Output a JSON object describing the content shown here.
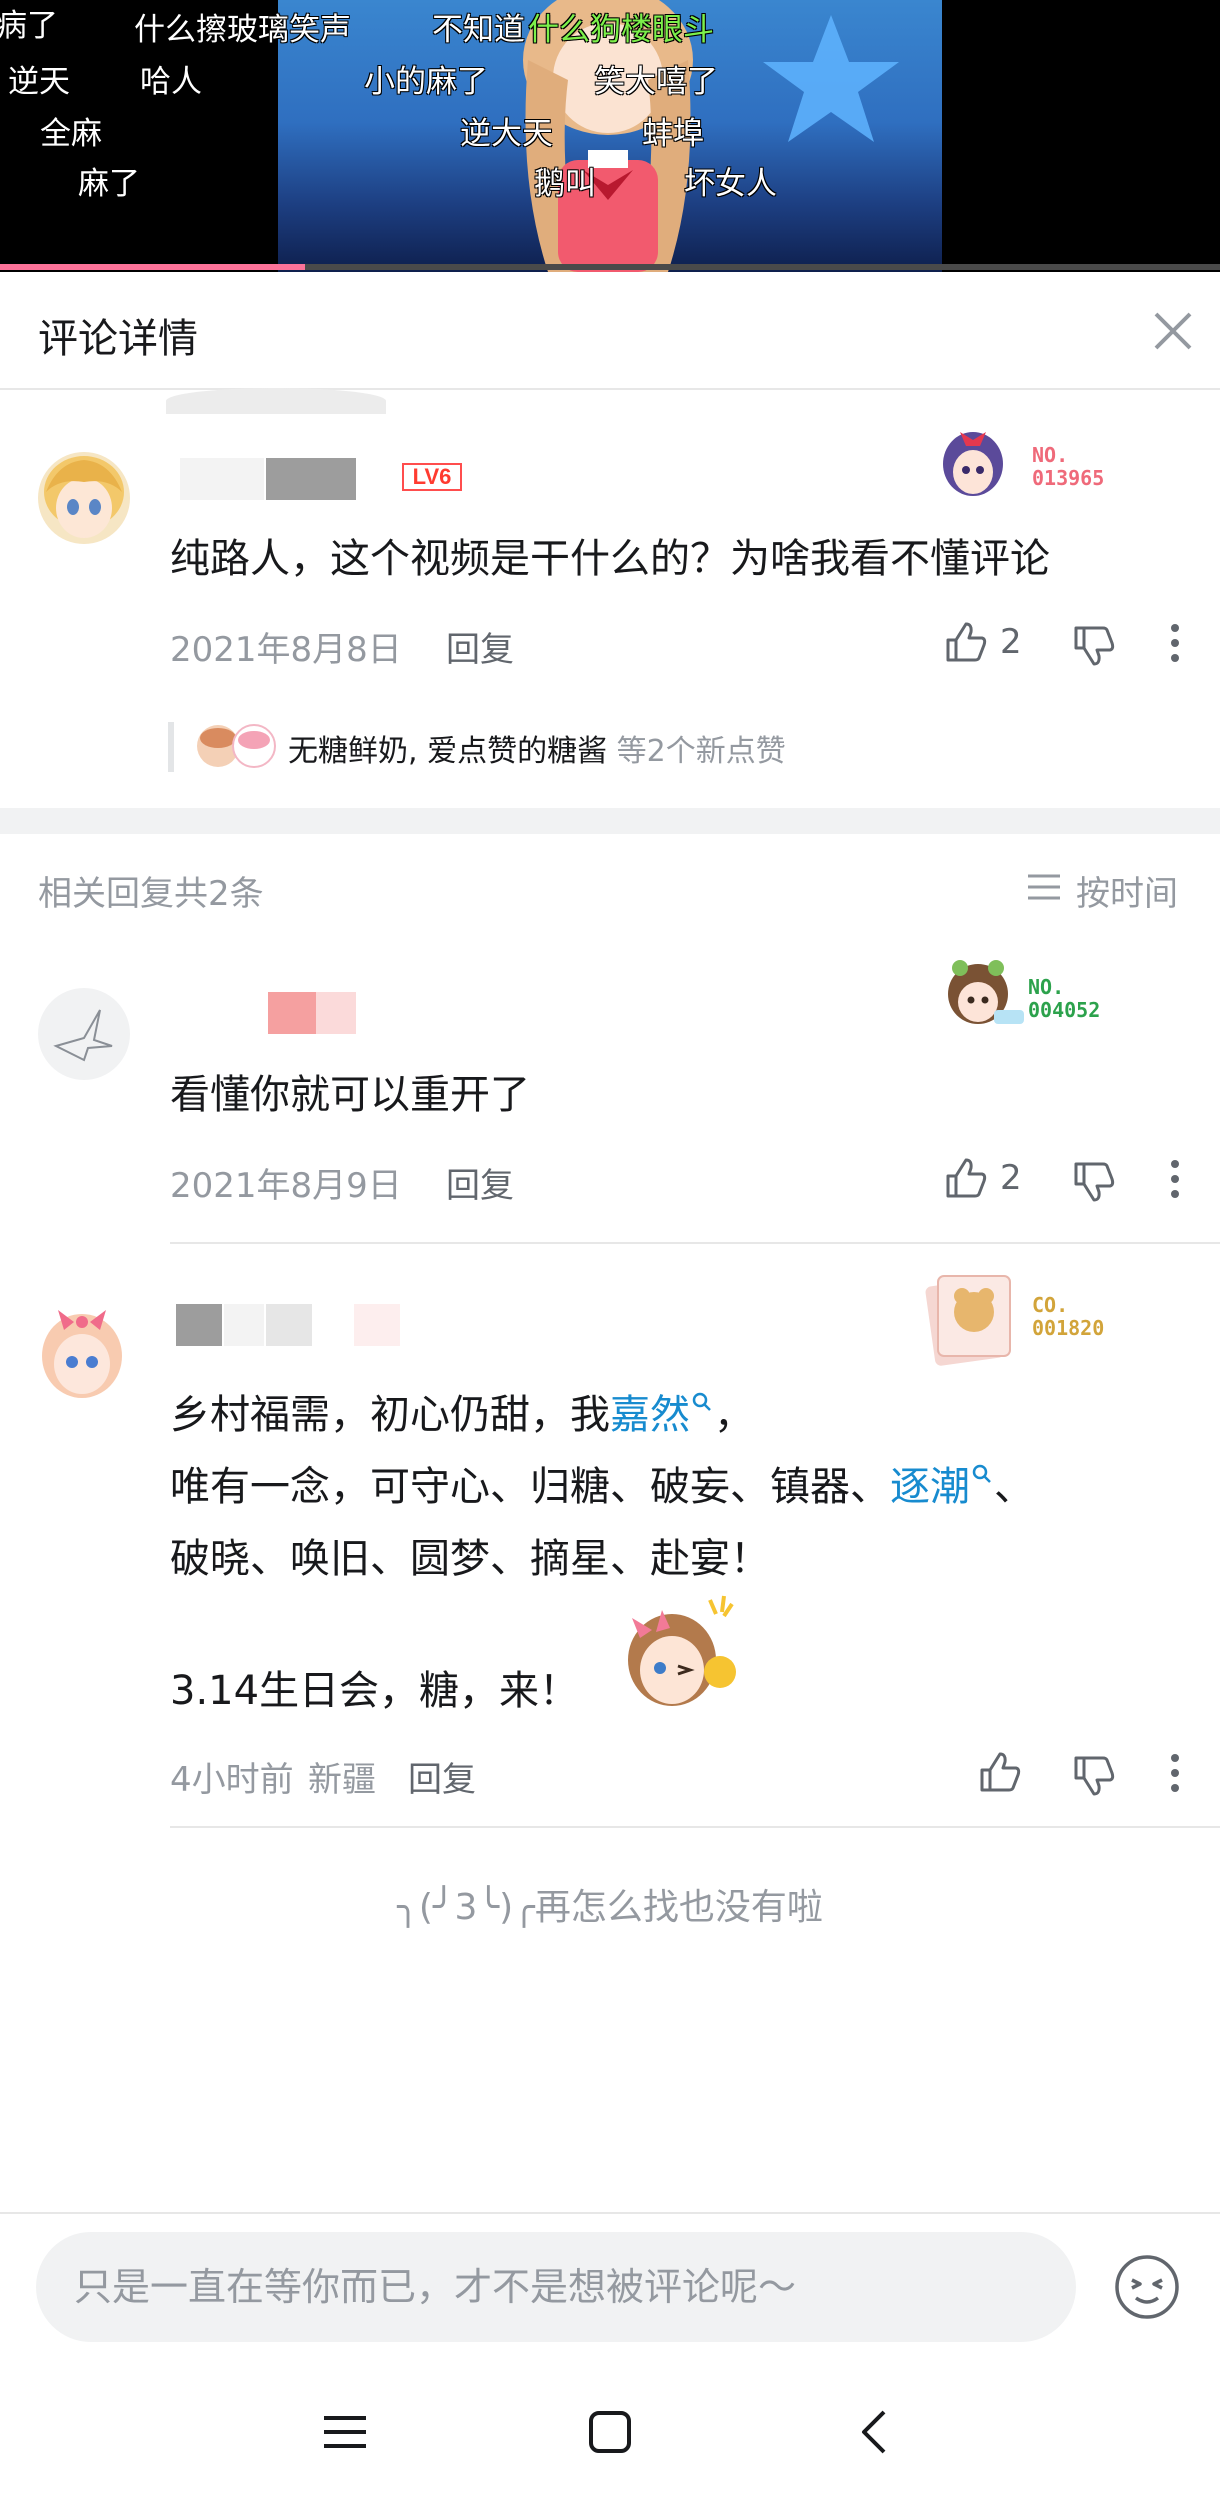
{
  "video": {
    "danmaku": [
      {
        "text": "病了",
        "green": false
      },
      {
        "text": "什么擦玻璃笑声",
        "green": false
      },
      {
        "text": "不知道",
        "green": false
      },
      {
        "text": "什么狗楼眼斗",
        "green": true
      },
      {
        "text": "逆天",
        "green": false
      },
      {
        "text": "哈人",
        "green": false
      },
      {
        "text": "小的麻了",
        "green": false
      },
      {
        "text": "笑大嘻了",
        "green": false
      },
      {
        "text": "全麻",
        "green": false
      },
      {
        "text": "逆大天",
        "green": false
      },
      {
        "text": "蚌埠",
        "green": false
      },
      {
        "text": "麻了",
        "green": false
      },
      {
        "text": "鹅叫",
        "green": false
      },
      {
        "text": "坏女人",
        "green": false
      }
    ],
    "progress_fraction": 0.25
  },
  "header": {
    "title": "评论详情",
    "close_icon": "close-icon"
  },
  "main_comment": {
    "level": "LV6",
    "badge_no": "NO.",
    "badge_num": "013965",
    "text": "纯路人，这个视频是干什么的？为啥我看不懂评论",
    "date": "2021年8月8日",
    "reply_label": "回复",
    "likes": "2",
    "likers_names": "无糖鲜奶, 爱点赞的糖酱",
    "likers_extra": " 等2个新点赞"
  },
  "replies_section": {
    "count_label": "相关回复共2条",
    "sort_label": "按时间"
  },
  "replies": [
    {
      "badge_no": "NO.",
      "badge_num": "004052",
      "text": "看懂你就可以重开了",
      "date": "2021年8月9日",
      "reply_label": "回复",
      "likes": "2"
    },
    {
      "badge_no": "CO.",
      "badge_num": "001820",
      "line1_pre": "乡村福需，初心仍甜，我",
      "line1_link": "嘉然",
      "line1_post": "，",
      "line2_pre": "唯有一念，可守心、归糖、破妄、镇器、",
      "line2_link": "逐潮",
      "line2_post": "、",
      "line3": "破晓、唤旧、圆梦、摘星、赴宴！",
      "line4": "3.14生日会，糖，来！",
      "time": "4小时前",
      "location": "新疆",
      "reply_label": "回复"
    }
  ],
  "end_text": "╮(╯3╰)╭再怎么找也没有啦",
  "input": {
    "placeholder": "只是一直在等你而已，才不是想被评论呢～"
  },
  "colors": {
    "accent_pink": "#fb7299",
    "link_blue": "#178bcf",
    "level_red": "#ff3b30",
    "badge_blue": "#3da8d8",
    "badge_green": "#2ca24c",
    "badge_gold": "#d2a43a"
  }
}
